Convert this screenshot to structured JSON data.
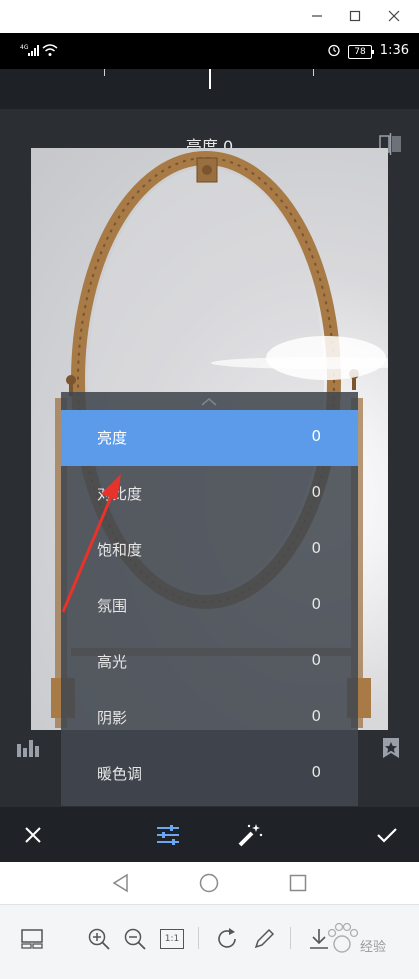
{
  "window": {
    "controls": [
      "minimize-icon",
      "maximize-icon",
      "close-icon"
    ]
  },
  "status_bar": {
    "network": "4G",
    "battery": "78",
    "time": "1:36"
  },
  "editor": {
    "title": "亮度 0",
    "menu_items": [
      {
        "label": "亮度",
        "value": "0",
        "selected": true
      },
      {
        "label": "对比度",
        "value": "0",
        "selected": false
      },
      {
        "label": "饱和度",
        "value": "0",
        "selected": false
      },
      {
        "label": "氛围",
        "value": "0",
        "selected": false
      },
      {
        "label": "高光",
        "value": "0",
        "selected": false
      },
      {
        "label": "阴影",
        "value": "0",
        "selected": false
      },
      {
        "label": "暖色调",
        "value": "0",
        "selected": false
      }
    ],
    "selected_color": "#5b9bea",
    "annotation_color": "#e8322a"
  },
  "toolbar": {
    "icons": [
      "close-icon",
      "tune-icon",
      "magic-wand-icon",
      "check-icon"
    ]
  },
  "viewer": {
    "zoom_fit_label": "1:1",
    "watermark_text": "经验"
  }
}
